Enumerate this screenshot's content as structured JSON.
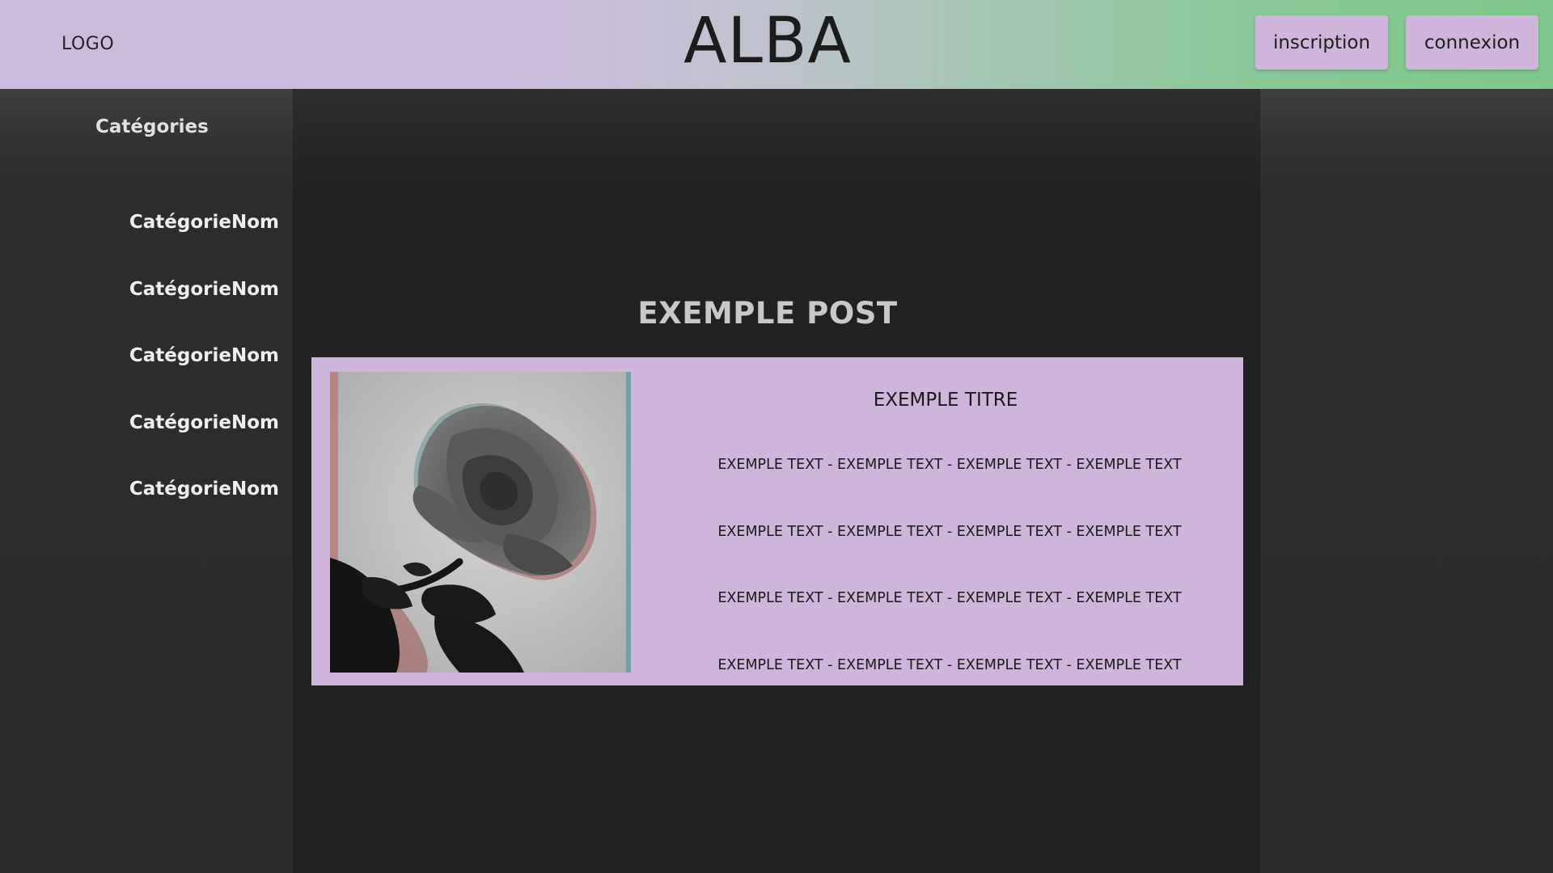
{
  "header": {
    "logo": "LOGO",
    "title": "ALBA",
    "inscription_label": "inscription",
    "connexion_label": "connexion"
  },
  "sidebar": {
    "title": "Catégories",
    "items": [
      {
        "label": "CatégorieNom"
      },
      {
        "label": "CatégorieNom"
      },
      {
        "label": "CatégorieNom"
      },
      {
        "label": "CatégorieNom"
      },
      {
        "label": "CatégorieNom"
      }
    ]
  },
  "main": {
    "section_title": "EXEMPLE POST",
    "post": {
      "image_icon": "rose-photo",
      "title": "EXEMPLE TITRE",
      "lines": [
        "EXEMPLE TEXT - EXEMPLE TEXT - EXEMPLE TEXT - EXEMPLE TEXT",
        "EXEMPLE TEXT - EXEMPLE TEXT - EXEMPLE TEXT - EXEMPLE TEXT",
        "EXEMPLE TEXT - EXEMPLE TEXT - EXEMPLE TEXT - EXEMPLE TEXT",
        "EXEMPLE TEXT - EXEMPLE TEXT - EXEMPLE TEXT - EXEMPLE TEXT"
      ]
    }
  },
  "colors": {
    "header_gradient_start": "#ccbcdb",
    "header_gradient_end": "#7ec78b",
    "button_bg": "#ceb5da",
    "card_bg": "#ceb5da",
    "page_bg": "#222222",
    "side_panel_bg": "#2b2b2b"
  }
}
